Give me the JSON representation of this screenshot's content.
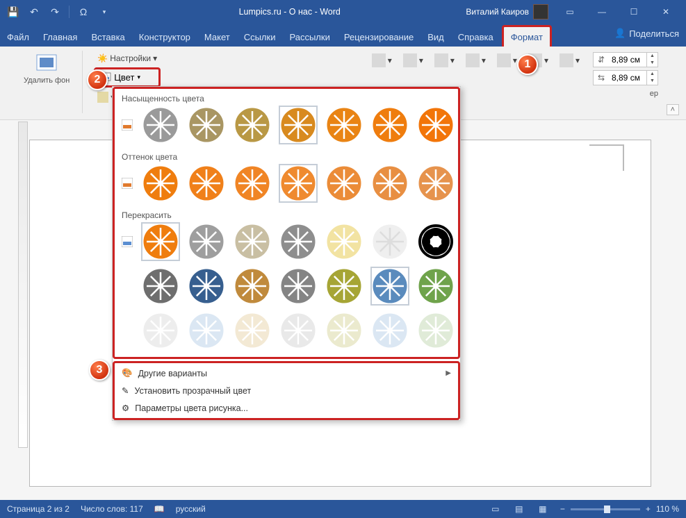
{
  "titlebar": {
    "doc_title": "Lumpics.ru - О нас  -  Word",
    "user": "Виталий Каиров"
  },
  "tabs": {
    "file": "Файл",
    "home": "Главная",
    "insert": "Вставка",
    "design": "Конструктор",
    "layout": "Макет",
    "references": "Ссылки",
    "mailings": "Рассылки",
    "review": "Рецензирование",
    "view": "Вид",
    "help": "Справка",
    "format": "Формат",
    "share": "Поделиться"
  },
  "ribbon": {
    "remove_bg": "Удалить фон",
    "corrections": "Настройки",
    "color": "Цвет",
    "size_h": "8,89 см",
    "size_w": "8,89 см",
    "group_size_extra": "ер"
  },
  "dropdown": {
    "saturation": "Насыщенность цвета",
    "tone": "Оттенок цвета",
    "recolor": "Перекрасить",
    "more_variants": "Другие варианты",
    "set_transparent": "Установить прозрачный цвет",
    "picture_color_options": "Параметры цвета рисунка...",
    "saturation_colors": [
      "#9a9a9a",
      "#a99663",
      "#b99845",
      "#d88a1f",
      "#e98414",
      "#ef7d0e",
      "#f27509"
    ],
    "tone_colors": [
      "#ef7d0e",
      "#f0801a",
      "#f08525",
      "#ef8a2f",
      "#eb8c38",
      "#e88f42",
      "#e6934d"
    ],
    "recolor_r1": [
      "#ef7d0e",
      "#9e9e9e",
      "#c9bfa3",
      "#8e8e8e",
      "#f2e3a2",
      "#efefef",
      "#000000"
    ],
    "recolor_r2": [
      "#6e6e6e",
      "#375f8f",
      "#c08a3c",
      "#848484",
      "#a6a535",
      "#5a8bbd",
      "#6fa34b"
    ],
    "recolor_r3": [
      "#e8e8e8",
      "#cfe0ef",
      "#efe2c6",
      "#e2e2e2",
      "#e5e4be",
      "#cfe0ef",
      "#d6e5cb"
    ]
  },
  "status": {
    "page": "Страница 2 из 2",
    "words": "Число слов: 117",
    "lang": "русский",
    "zoom": "110 %"
  },
  "badges": {
    "b1": "1",
    "b2": "2",
    "b3": "3"
  }
}
